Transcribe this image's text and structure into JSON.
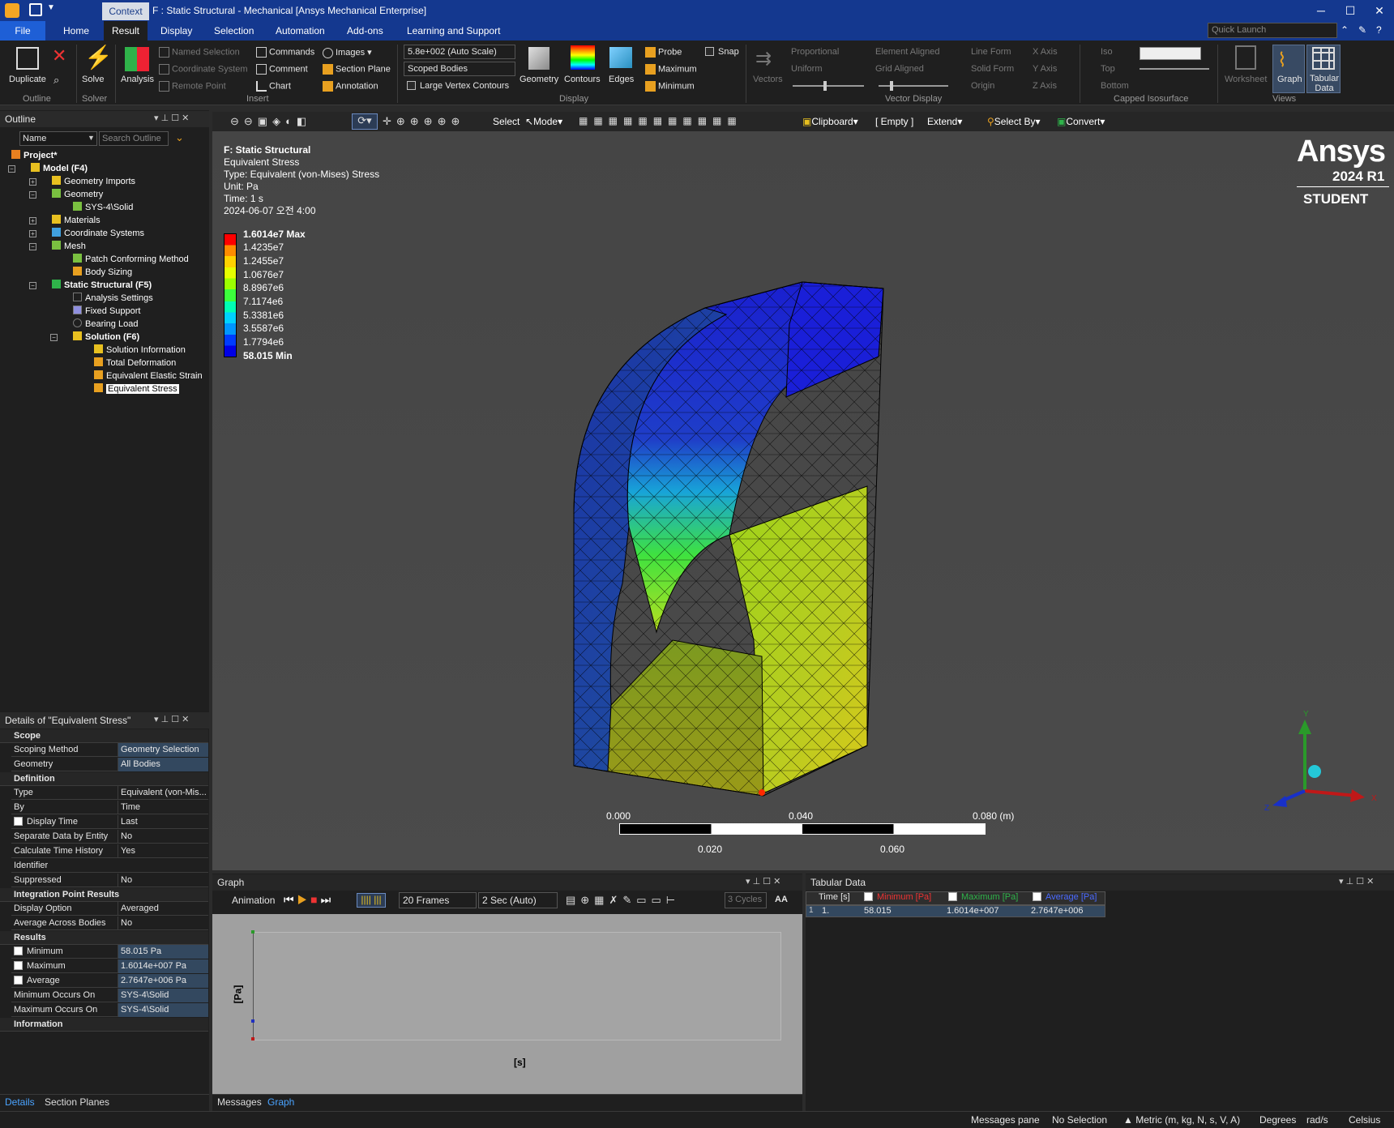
{
  "window": {
    "context_tab": "Context",
    "title": "F : Static Structural - Mechanical [Ansys Mechanical Enterprise]",
    "quick_launch_placeholder": "Quick Launch"
  },
  "menu": [
    "File",
    "Home",
    "Result",
    "Display",
    "Selection",
    "Automation",
    "Add-ons",
    "Learning and Support"
  ],
  "ribbon": {
    "duplicate": "Duplicate",
    "solve": "Solve",
    "analysis": "Analysis",
    "named_selection": "Named Selection",
    "coordinate_system": "Coordinate System",
    "remote_point": "Remote Point",
    "commands": "Commands",
    "comment": "Comment",
    "chart": "Chart",
    "images": "Images",
    "section_plane": "Section Plane",
    "annotation": "Annotation",
    "scale_value": "5.8e+002 (Auto Scale)",
    "scoped_bodies": "Scoped Bodies",
    "large_vertex": "Large Vertex Contours",
    "geometry": "Geometry",
    "contours": "Contours",
    "edges": "Edges",
    "probe": "Probe",
    "maximum": "Maximum",
    "minimum": "Minimum",
    "snap": "Snap",
    "vectors": "Vectors",
    "proportional": "Proportional",
    "uniform": "Uniform",
    "element_aligned": "Element Aligned",
    "grid_aligned": "Grid Aligned",
    "line_form": "Line Form",
    "solid_form": "Solid Form",
    "origin": "Origin",
    "x_axis": "X Axis",
    "y_axis": "Y Axis",
    "z_axis": "Z Axis",
    "iso": "Iso",
    "top": "Top",
    "bottom": "Bottom",
    "worksheet": "Worksheet",
    "graph": "Graph",
    "tabular": "Tabular Data",
    "groups": {
      "outline": "Outline",
      "solver": "Solver",
      "insert": "Insert",
      "display": "Display",
      "vector_display": "Vector Display",
      "capped": "Capped Isosurface",
      "views": "Views"
    }
  },
  "viewtoolbar": {
    "select": "Select",
    "mode": "Mode",
    "clipboard": "Clipboard",
    "empty": "[ Empty ]",
    "extend": "Extend",
    "select_by": "Select By",
    "convert": "Convert"
  },
  "outline": {
    "title": "Outline",
    "name_filter": "Name",
    "search_placeholder": "Search Outline",
    "tree": [
      {
        "label": "Project*",
        "bold": true
      },
      {
        "label": "Model (F4)",
        "bold": true
      },
      {
        "label": "Geometry Imports"
      },
      {
        "label": "Geometry"
      },
      {
        "label": "SYS-4\\Solid"
      },
      {
        "label": "Materials"
      },
      {
        "label": "Coordinate Systems"
      },
      {
        "label": "Mesh"
      },
      {
        "label": "Patch Conforming Method"
      },
      {
        "label": "Body Sizing"
      },
      {
        "label": "Static Structural (F5)",
        "bold": true
      },
      {
        "label": "Analysis Settings"
      },
      {
        "label": "Fixed Support"
      },
      {
        "label": "Bearing Load"
      },
      {
        "label": "Solution (F6)",
        "bold": true
      },
      {
        "label": "Solution Information"
      },
      {
        "label": "Total Deformation"
      },
      {
        "label": "Equivalent Elastic Strain"
      },
      {
        "label": "Equivalent Stress"
      }
    ]
  },
  "details": {
    "title": "Details of \"Equivalent Stress\"",
    "scope": "Scope",
    "scoping_method": [
      "Scoping Method",
      "Geometry Selection"
    ],
    "geometry": [
      "Geometry",
      "All Bodies"
    ],
    "definition": "Definition",
    "type": [
      "Type",
      "Equivalent (von-Mis..."
    ],
    "by": [
      "By",
      "Time"
    ],
    "display_time": [
      "Display Time",
      "Last"
    ],
    "separate": [
      "Separate Data by Entity",
      "No"
    ],
    "calc_history": [
      "Calculate Time History",
      "Yes"
    ],
    "identifier": [
      "Identifier",
      ""
    ],
    "suppressed": [
      "Suppressed",
      "No"
    ],
    "ipr": "Integration Point Results",
    "display_option": [
      "Display Option",
      "Averaged"
    ],
    "avg_across": [
      "Average Across Bodies",
      "No"
    ],
    "results": "Results",
    "minimum": [
      "Minimum",
      "58.015 Pa"
    ],
    "maximum": [
      "Maximum",
      "1.6014e+007 Pa"
    ],
    "average": [
      "Average",
      "2.7647e+006 Pa"
    ],
    "min_on": [
      "Minimum Occurs On",
      "SYS-4\\Solid"
    ],
    "max_on": [
      "Maximum Occurs On",
      "SYS-4\\Solid"
    ],
    "information": "Information"
  },
  "left_tabs": {
    "details": "Details",
    "section": "Section Planes"
  },
  "result_info": {
    "l1": "F: Static Structural",
    "l2": "Equivalent Stress",
    "l3": "Type: Equivalent (von-Mises) Stress",
    "l4": "Unit: Pa",
    "l5": "Time: 1 s",
    "l6": "2024-06-07 오전 4:00"
  },
  "legend": {
    "max": "1.6014e7 Max",
    "values": [
      "1.4235e7",
      "1.2455e7",
      "1.0676e7",
      "8.8967e6",
      "7.1174e6",
      "5.3381e6",
      "3.5587e6",
      "1.7794e6"
    ],
    "min": "58.015 Min",
    "colors": [
      "#ff0000",
      "#ff8c00",
      "#ffd200",
      "#e6ff00",
      "#9cff00",
      "#3cff3c",
      "#00ffb4",
      "#00d2ff",
      "#0096ff",
      "#003cff",
      "#0000e6"
    ]
  },
  "brand": {
    "name": "Ansys",
    "version": "2024 R1",
    "edition": "STUDENT"
  },
  "scale": {
    "t0": "0.000",
    "t1": "0.040",
    "t2": "0.080 (m)",
    "b1": "0.020",
    "b2": "0.060"
  },
  "triad": {
    "x": "X",
    "y": "Y",
    "z": "Z"
  },
  "graph": {
    "title": "Graph",
    "animation": "Animation",
    "frames": "20 Frames",
    "duration": "2 Sec (Auto)",
    "cycles": "3 Cycles",
    "aa": "AA",
    "ylabel": "[Pa]",
    "xlabel": "[s]",
    "tab_messages": "Messages",
    "tab_graph": "Graph"
  },
  "tabular": {
    "title": "Tabular Data",
    "headers": [
      "Time [s]",
      "Minimum [Pa]",
      "Maximum [Pa]",
      "Average [Pa]"
    ],
    "row": [
      "1",
      "1.",
      "58.015",
      "1.6014e+007",
      "2.7647e+006"
    ]
  },
  "status": {
    "messages": "Messages pane",
    "selection": "No Selection",
    "units": "Metric (m, kg, N, s, V, A)",
    "degrees": "Degrees",
    "rads": "rad/s",
    "celsius": "Celsius"
  }
}
